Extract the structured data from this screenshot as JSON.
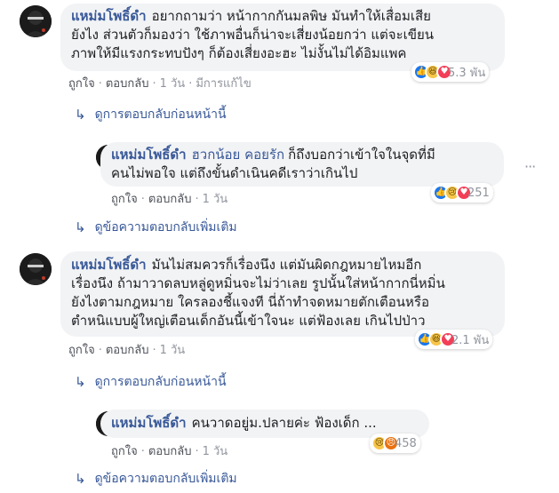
{
  "comments": [
    {
      "author": "แหม่มโพธิ์ดำ",
      "text_lines": [
        "อยากถามว่า หน้ากากกันมลพิษ มันทำให้เสื่อมเสีย",
        "ยังไง ส่วนตัวก็มองว่า ใช้ภาพอื่นก็น่าจะเสี่ยงน้อยกว่า แต่จะเขียน",
        "ภาพให้มีแรงกระทบปังๆ ก็ต้องเสี่ยงอะฮะ ไม่งั้นไม่ได้อิมแพค"
      ],
      "like": "ถูกใจ",
      "reply": "ตอบกลับ",
      "time": "1 วัน",
      "edited": "มีการแก้ไข",
      "reaction_icons": [
        "like-icon",
        "haha-icon",
        "love-icon"
      ],
      "reaction_count": "5.3 พัน",
      "view_replies": "ดูการตอบกลับก่อนหน้านี้"
    },
    {
      "author": "แหม่มโพธิ์ดำ",
      "mention": "ฮวกน้อย คอยรัก",
      "text_lines_first": "ก็ถึงบอกว่าเข้าใจในจุดที่มี",
      "text_lines": [
        "คนไม่พอใจ แต่ถึงขั้นดำเนินคดีเราว่าเกินไป"
      ],
      "like": "ถูกใจ",
      "reply": "ตอบกลับ",
      "time": "1 วัน",
      "reaction_icons": [
        "like-icon",
        "sad-icon",
        "love-icon"
      ],
      "reaction_count": "251",
      "view_more": "ดูข้อความตอบกลับเพิ่มเติม"
    },
    {
      "author": "แหม่มโพธิ์ดำ",
      "text_lines": [
        "มันไม่สมควรก็เรื่องนึง แต่มันผิดกฎหมายไหมอีก",
        "เรื่องนึง ถ้ามาวาดลบหลู่ดูหมิ่นจะไม่ว่าเลย รูปนั้นใส่หน้ากากนี่หมิ่น",
        "ยังไงตามกฎหมาย ใครลองชี้แจงที นี่ถ้าทำจดหมายตักเตือนหรือ",
        "ตำหนิแบบผู้ใหญ่เตือนเด็กอันนี้เข้าใจนะ แต่ฟ้องเลย เกินไปป่าว"
      ],
      "like": "ถูกใจ",
      "reply": "ตอบกลับ",
      "time": "1 วัน",
      "reaction_icons": [
        "like-icon",
        "haha-icon",
        "love-icon"
      ],
      "reaction_count": "2.1 พัน",
      "view_replies": "ดูการตอบกลับก่อนหน้านี้"
    },
    {
      "author": "แหม่มโพธิ์ดำ",
      "text": "คนวาดอยู่ม.ปลายค่ะ ฟ้องเด็ก ...",
      "like": "ถูกใจ",
      "reply": "ตอบกลับ",
      "time": "1 วัน",
      "reaction_icons": [
        "sad-icon",
        "angry-icon"
      ],
      "reaction_count": "458",
      "view_more": "ดูข้อความตอบกลับเพิ่มเติม"
    }
  ],
  "icons": {
    "reply_arrow": "reply-arrow-icon",
    "more": "more-options-icon"
  }
}
